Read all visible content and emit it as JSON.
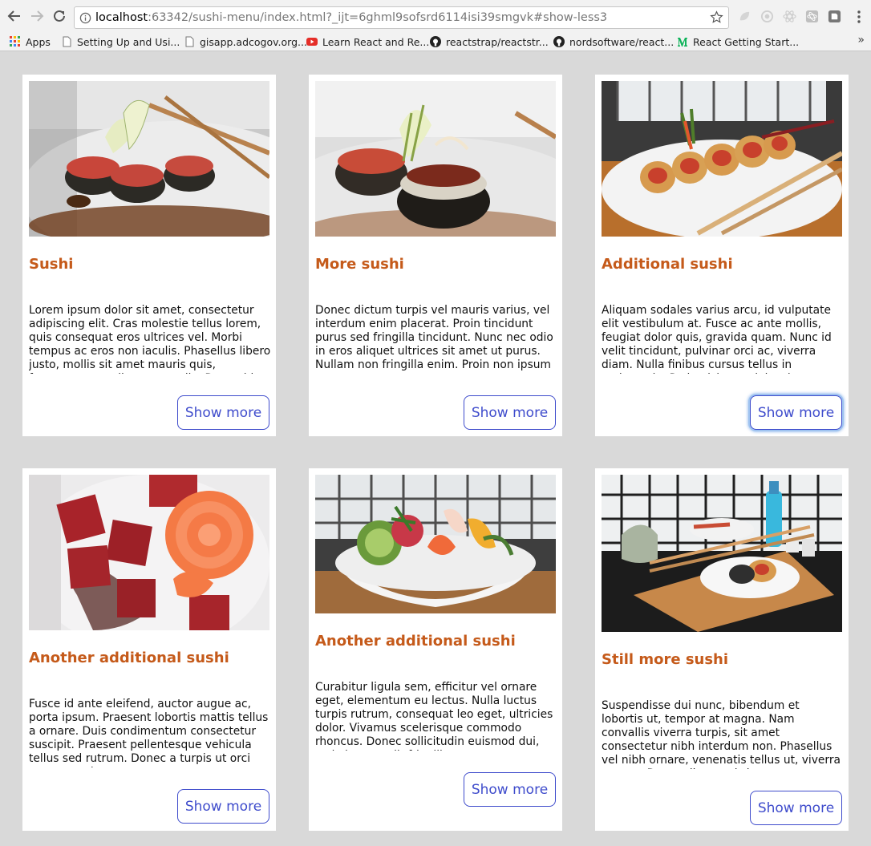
{
  "browser": {
    "url_host": "localhost",
    "url_rest": ":63342/sushi-menu/index.html?_ijt=6ghml9sofsrd6114isi39smgvk#show-less3",
    "bookmarks": [
      {
        "label": "Apps",
        "icon": "apps-grid-icon"
      },
      {
        "label": "Setting Up and Usi...",
        "icon": "page-icon"
      },
      {
        "label": "gisapp.adcogov.org...",
        "icon": "page-icon"
      },
      {
        "label": "Learn React and Re...",
        "icon": "youtube-icon"
      },
      {
        "label": "reactstrap/reactstr...",
        "icon": "github-icon"
      },
      {
        "label": "nordsoftware/react...",
        "icon": "github-icon"
      },
      {
        "label": "React Getting Start...",
        "icon": "medium-icon"
      }
    ]
  },
  "menu": {
    "button_label": "Show more",
    "title_color": "#c55a1a",
    "button_color": "#3f4ccc",
    "cards": [
      {
        "title": "Sushi",
        "image": "sushi-rolls-plate-photo",
        "body": "Lorem ipsum dolor sit amet, consectetur adipiscing elit. Cras molestie tellus lorem, quis consequat eros ultrices vel. Morbi tempus ac eros non iaculis. Phasellus libero justo, mollis sit amet mauris quis, fermentum condimentum odio. Donec id"
      },
      {
        "title": "More sushi",
        "image": "sushi-rolls-closeup-photo",
        "body": "Donec dictum turpis vel mauris varius, vel interdum enim placerat. Proin tincidunt purus sed fringilla tincidunt. Nunc nec odio in eros aliquet ultrices sit amet ut purus. Nullam non fringilla enim. Proin non ipsum ante."
      },
      {
        "title": "Additional sushi",
        "image": "sushi-roll-chopsticks-photo",
        "body": "Aliquam sodales varius arcu, id vulputate elit vestibulum at. Fusce ac ante mollis, feugiat dolor quis, gravida quam. Nunc id velit tincidunt, pulvinar orci ac, viverra diam. Nulla finibus cursus tellus in malesuada. Proin nisi ante, lobortis non"
      },
      {
        "title": "Another additional sushi",
        "image": "salmon-rose-sashimi-photo",
        "body": "Fusce id ante eleifend, auctor augue ac, porta ipsum. Praesent lobortis mattis tellus a ornare. Duis condimentum consectetur suscipit. Praesent pellentesque vehicula tellus sed rutrum. Donec a turpis ut orci tempor varius."
      },
      {
        "title": "Another additional sushi",
        "image": "sashimi-bowl-photo",
        "body": "Curabitur ligula sem, efficitur vel ornare eget, elementum eu lectus. Nulla luctus turpis rutrum, consequat leo eget, ultricies dolor. Vivamus scelerisque commodo rhoncus. Donec sollicitudin euismod dui, sed viverra velit fringilla ac."
      },
      {
        "title": "Still more sushi",
        "image": "sushi-table-setting-photo",
        "body": "Suspendisse dui nunc, bibendum et lobortis ut, tempor at magna. Nam convallis viverra turpis, sit amet consectetur nibh interdum non. Phasellus vel nibh ornare, venenatis tellus ut, viverra magna. Donec dictum ultrices"
      }
    ]
  }
}
